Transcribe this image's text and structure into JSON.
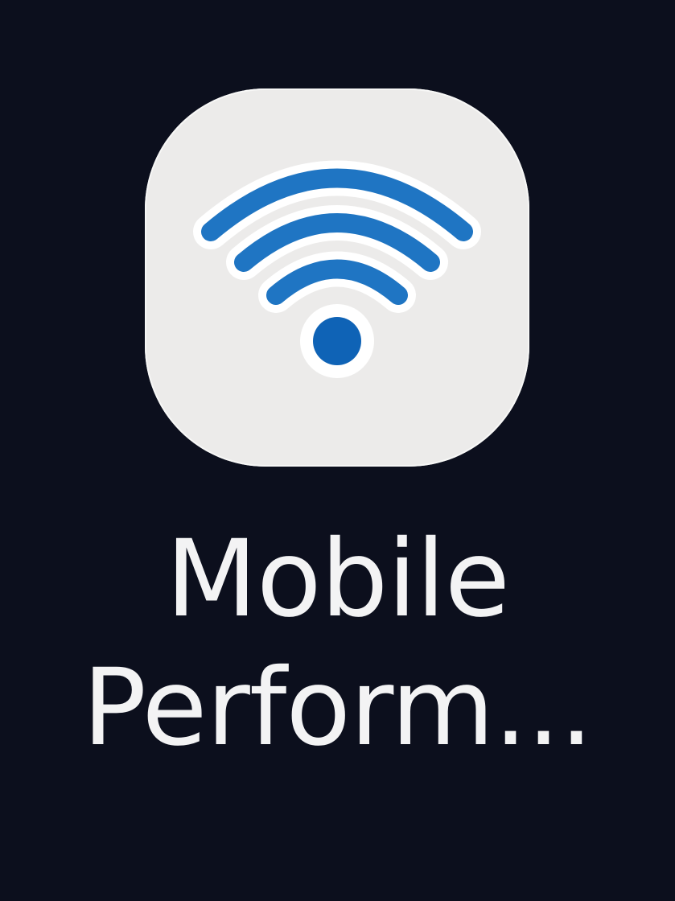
{
  "home_screen": {
    "background_color": "#0c0f1d",
    "app": {
      "label_line_1": "Mobile",
      "label_line_2": "Perform...",
      "icon": "wifi-icon",
      "icon_background_color": "#ecebea",
      "icon_accent_color": "#1f75c3"
    }
  }
}
